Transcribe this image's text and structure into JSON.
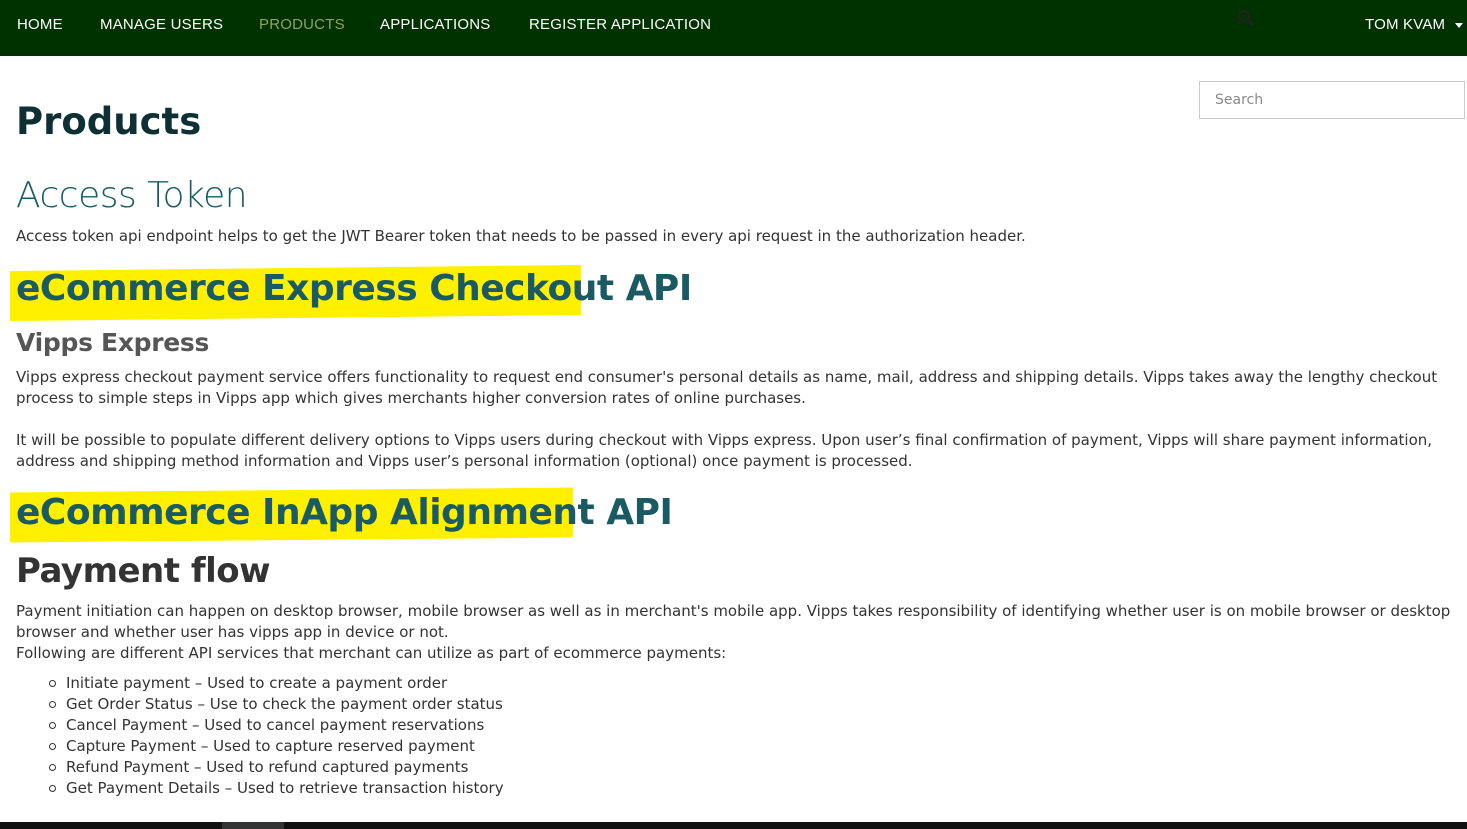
{
  "nav": {
    "items": [
      {
        "label": "HOME"
      },
      {
        "label": "MANAGE USERS"
      },
      {
        "label": "PRODUCTS"
      },
      {
        "label": "APPLICATIONS"
      },
      {
        "label": "REGISTER APPLICATION"
      }
    ],
    "active": "PRODUCTS",
    "user": "TOM KVAM",
    "active_color": "#8fa35a",
    "bar_color": "#003200"
  },
  "search": {
    "placeholder": "Search",
    "icon": "search-icon"
  },
  "page": {
    "title": "Products"
  },
  "sections": {
    "access_token": {
      "heading": "Access Token",
      "text": "Access token api endpoint helps to get the JWT Bearer token that needs to be passed in every api request in the authorization header."
    },
    "express": {
      "heading": "eCommerce Express Checkout API",
      "subheading": "Vipps Express",
      "para1": "Vipps express checkout payment service offers functionality to request end consumer's personal details as name, mail, address and shipping details. Vipps takes away the lengthy checkout process to simple steps in Vipps app which gives merchants higher conversion rates of online purchases.",
      "para2": "It will be possible to populate different delivery options to Vipps users during checkout with Vipps express. Upon user’s final confirmation of payment, Vipps will share payment information, address and shipping method information and Vipps user’s personal information (optional) once payment is processed."
    },
    "inapp": {
      "heading": "eCommerce InApp Alignment API",
      "subheading": "Payment flow",
      "para1": "Payment initiation can happen on desktop browser, mobile browser as well as in merchant's mobile app. Vipps takes responsibility of identifying whether user is on mobile browser or desktop browser and whether user has vipps app in device or not.",
      "para2": "Following are different API services that merchant can utilize as part of ecommerce payments:",
      "services": [
        "Initiate payment – Used to create a payment order",
        "Get Order Status – Use to check the payment order status",
        "Cancel Payment – Used to cancel payment reservations",
        "Capture Payment – Used to capture reserved payment",
        "Refund Payment – Used to refund captured payments",
        "Get Payment Details – Used to retrieve transaction history"
      ]
    }
  },
  "highlight_color": "#fff000"
}
